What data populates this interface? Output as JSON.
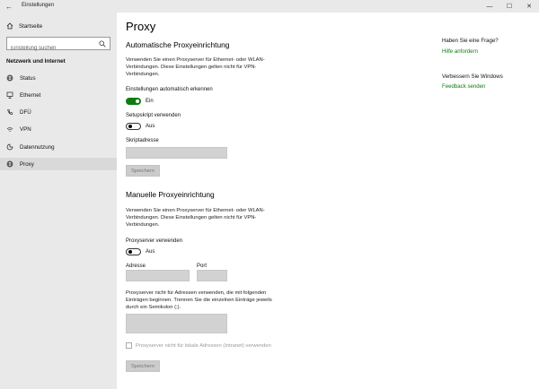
{
  "window": {
    "title": "Einstellungen",
    "back": "←",
    "minimize": "—",
    "maximize": "☐",
    "close": "✕"
  },
  "sidebar": {
    "home": "Startseite",
    "search_placeholder": "Einstellung suchen",
    "section": "Netzwerk und Internet",
    "items": [
      {
        "label": "Status",
        "icon": "globe-icon"
      },
      {
        "label": "Ethernet",
        "icon": "ethernet-icon"
      },
      {
        "label": "DFÜ",
        "icon": "phone-icon"
      },
      {
        "label": "VPN",
        "icon": "vpn-icon"
      },
      {
        "label": "Datennutzung",
        "icon": "data-usage-icon"
      },
      {
        "label": "Proxy",
        "icon": "proxy-globe-icon"
      }
    ]
  },
  "main": {
    "title": "Proxy",
    "auto": {
      "title": "Automatische Proxyeinrichtung",
      "desc": "Verwenden Sie einen Proxyserver für Ethernet- oder WLAN-Verbindungen. Diese Einstellungen gelten nicht für VPN-Verbindungen.",
      "detect_label": "Einstellungen automatisch erkennen",
      "detect_state": "Ein",
      "script_label": "Setupskript verwenden",
      "script_state": "Aus",
      "address_label": "Skriptadresse",
      "save": "Speichern"
    },
    "manual": {
      "title": "Manuelle Proxyeinrichtung",
      "desc": "Verwenden Sie einen Proxyserver für Ethernet- oder WLAN-Verbindungen. Diese Einstellungen gelten nicht für VPN-Verbindungen.",
      "proxy_label": "Proxyserver verwenden",
      "proxy_state": "Aus",
      "address_label": "Adresse",
      "port_label": "Port",
      "exceptions_desc": "Proxyserver nicht für Adressen verwenden, die mit folgenden Einträgen beginnen. Trennen Sie die einzelnen Einträge jeweils durch ein Semikolon (;).",
      "local_checkbox": "Proxyserver nicht für lokale Adressen (Intranet) verwenden",
      "save": "Speichern"
    }
  },
  "help": {
    "question": "Haben Sie eine Frage?",
    "help_link": "Hilfe anfordern",
    "improve": "Verbessern Sie Windows",
    "feedback_link": "Feedback senden"
  },
  "colors": {
    "accent": "#107c10",
    "sidebar_bg": "#e9e9e9"
  }
}
